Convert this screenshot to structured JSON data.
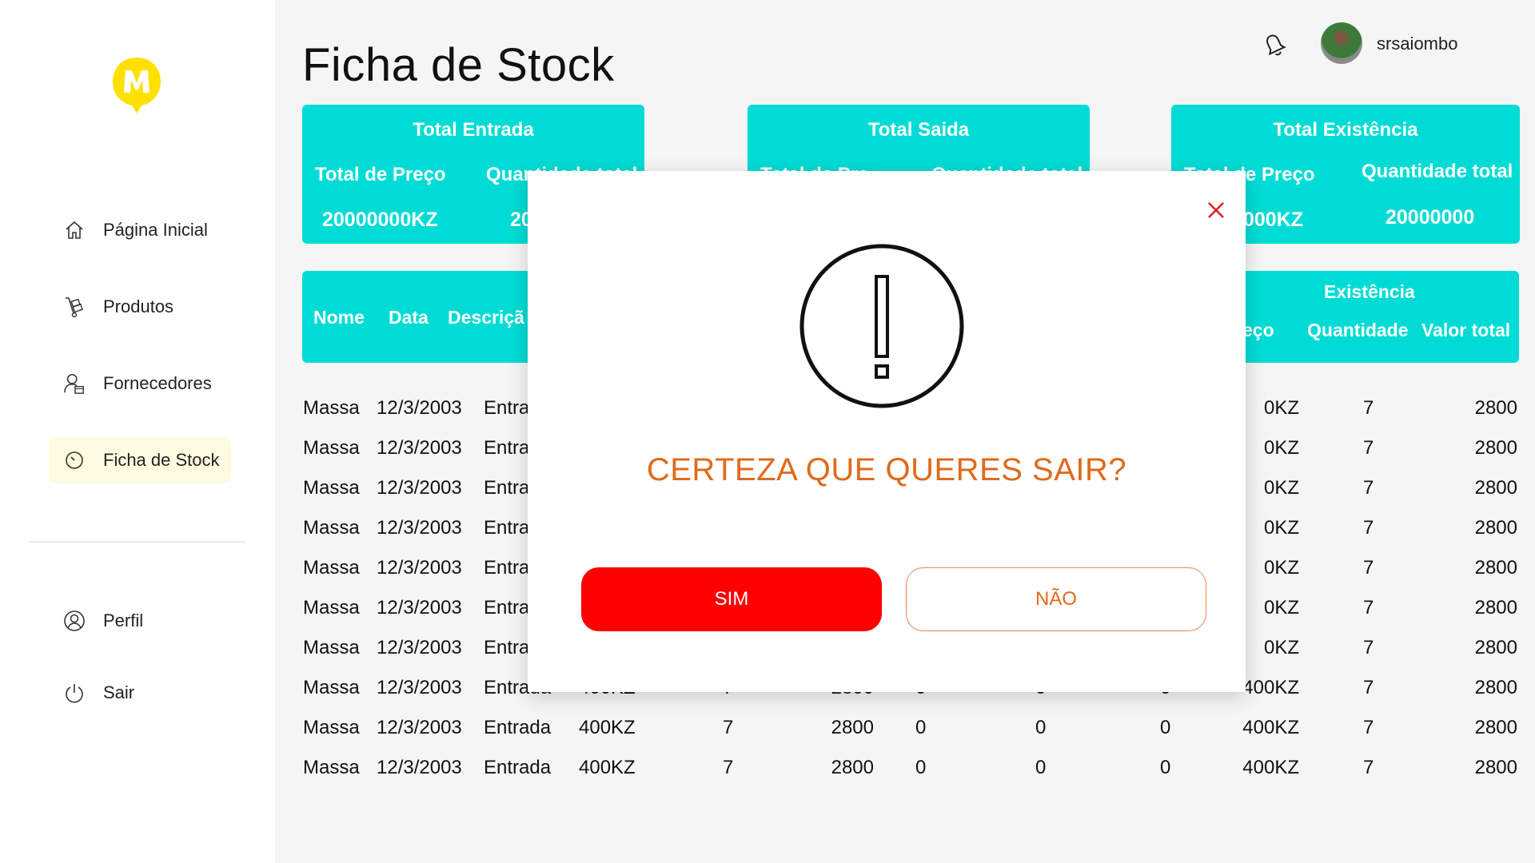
{
  "header": {
    "title": "Ficha de Stock",
    "username": "srsaiombo"
  },
  "sidebar": {
    "items": [
      {
        "label": "Página Inicial",
        "icon": "home-icon"
      },
      {
        "label": "Produtos",
        "icon": "hand-truck-icon"
      },
      {
        "label": "Fornecedores",
        "icon": "user-box-icon"
      },
      {
        "label": "Ficha de Stock",
        "icon": "clock-icon",
        "active": true
      },
      {
        "label": "Perfil",
        "icon": "profile-icon"
      },
      {
        "label": "Sair",
        "icon": "power-icon"
      }
    ]
  },
  "cards": [
    {
      "title": "Total Entrada",
      "sub1": "Total de Preço",
      "sub2": "Quantidade total",
      "val1": "20000000KZ",
      "val2": "20"
    },
    {
      "title": "Total Saida",
      "sub1": "Total de Pre",
      "sub2": "Quantidade total",
      "val1": "",
      "val2": ""
    },
    {
      "title": "Total Existência",
      "sub1": "Total de Preço",
      "sub2": "Quantidade total",
      "val1": "000KZ",
      "val2": "20000000"
    }
  ],
  "table": {
    "headers": {
      "nome": "Nome",
      "data": "Data",
      "descricao": "Descriçã",
      "existencia": "Existência",
      "preco": "eço",
      "quantidade": "Quantidade",
      "valor_total": "Valor total"
    },
    "rows": [
      [
        "Massa",
        "12/3/2003",
        "Entra",
        "",
        "",
        "",
        "",
        "",
        "",
        "0KZ",
        "7",
        "2800"
      ],
      [
        "Massa",
        "12/3/2003",
        "Entra",
        "",
        "",
        "",
        "",
        "",
        "",
        "0KZ",
        "7",
        "2800"
      ],
      [
        "Massa",
        "12/3/2003",
        "Entra",
        "",
        "",
        "",
        "",
        "",
        "",
        "0KZ",
        "7",
        "2800"
      ],
      [
        "Massa",
        "12/3/2003",
        "Entra",
        "",
        "",
        "",
        "",
        "",
        "",
        "0KZ",
        "7",
        "2800"
      ],
      [
        "Massa",
        "12/3/2003",
        "Entra",
        "",
        "",
        "",
        "",
        "",
        "",
        "0KZ",
        "7",
        "2800"
      ],
      [
        "Massa",
        "12/3/2003",
        "Entra",
        "",
        "",
        "",
        "",
        "",
        "",
        "0KZ",
        "7",
        "2800"
      ],
      [
        "Massa",
        "12/3/2003",
        "Entra",
        "",
        "",
        "",
        "",
        "",
        "",
        "0KZ",
        "7",
        "2800"
      ],
      [
        "Massa",
        "12/3/2003",
        "Entrada",
        "400KZ",
        "7",
        "2800",
        "0",
        "0",
        "0",
        "400KZ",
        "7",
        "2800"
      ],
      [
        "Massa",
        "12/3/2003",
        "Entrada",
        "400KZ",
        "7",
        "2800",
        "0",
        "0",
        "0",
        "400KZ",
        "7",
        "2800"
      ],
      [
        "Massa",
        "12/3/2003",
        "Entrada",
        "400KZ",
        "7",
        "2800",
        "0",
        "0",
        "0",
        "400KZ",
        "7",
        "2800"
      ]
    ]
  },
  "modal": {
    "message": "CERTEZA QUE QUERES SAIR?",
    "confirm_label": "SIM",
    "cancel_label": "NÃO"
  },
  "colors": {
    "accent": "#00dcd5",
    "danger": "#ff0000",
    "warning_text": "#e06a1b",
    "logo": "#ffe000",
    "active_nav_bg": "#fffbe0"
  }
}
